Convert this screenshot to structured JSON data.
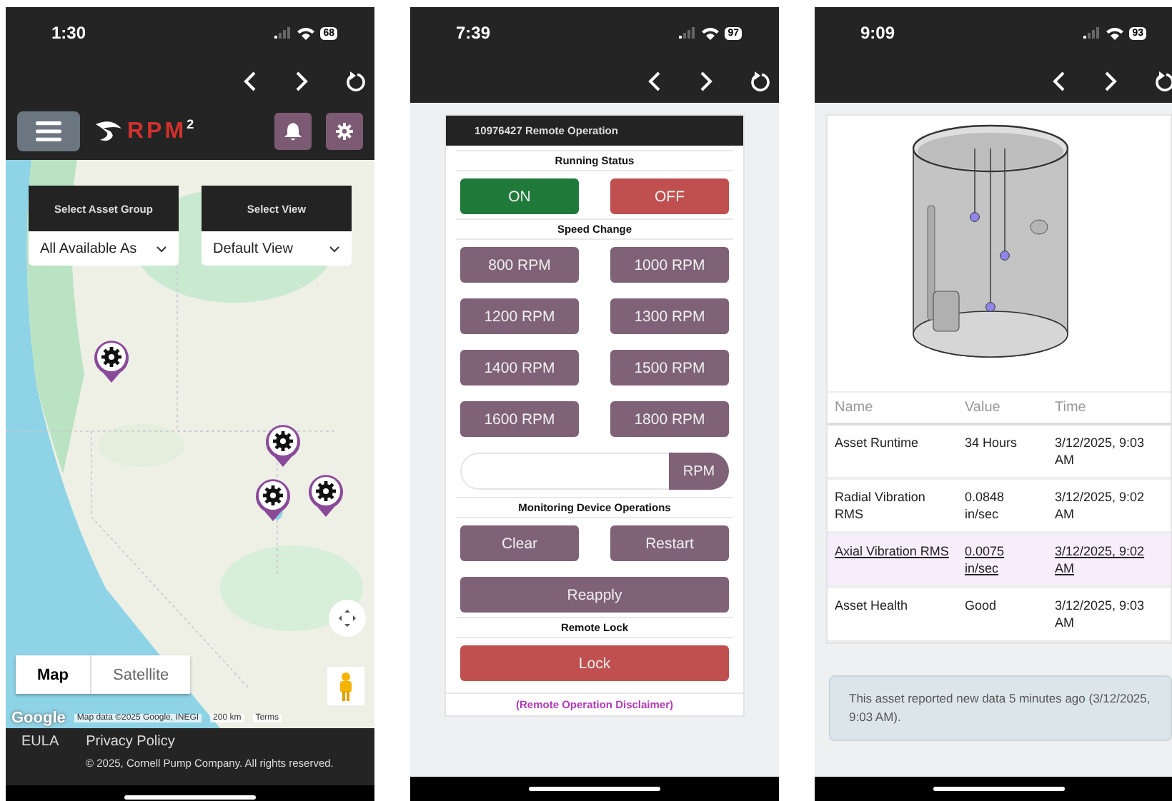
{
  "phones": [
    {
      "kind": "map",
      "time": "1:30",
      "battery": "68",
      "logo_text": "RPM",
      "logo_sup": "2",
      "selects": [
        {
          "label": "Select Asset Group",
          "value": "All Available As"
        },
        {
          "label": "Select View",
          "value": "Default View"
        }
      ],
      "map_types": [
        {
          "label": "Map",
          "selected": true
        },
        {
          "label": "Satellite",
          "selected": false
        }
      ],
      "attribution": {
        "logo": "Google",
        "data": "Map data ©2025 Google, INEGI",
        "scale": "200 km",
        "terms": "Terms"
      },
      "footer": {
        "links": [
          "EULA",
          "Privacy Policy"
        ],
        "copyright": "© 2025, Cornell Pump Company. All rights reserved."
      }
    },
    {
      "kind": "remote",
      "time": "7:39",
      "battery": "97",
      "title": "10976427 Remote Operation",
      "sections": [
        {
          "heading": "Running Status",
          "buttons": [
            {
              "label": "ON",
              "kind": "on"
            },
            {
              "label": "OFF",
              "kind": "off"
            }
          ]
        },
        {
          "heading": "Speed Change",
          "buttons": [
            {
              "label": "800 RPM",
              "kind": "action"
            },
            {
              "label": "1000 RPM",
              "kind": "action"
            },
            {
              "label": "1200 RPM",
              "kind": "action"
            },
            {
              "label": "1300 RPM",
              "kind": "action"
            },
            {
              "label": "1400 RPM",
              "kind": "action"
            },
            {
              "label": "1500 RPM",
              "kind": "action"
            },
            {
              "label": "1600 RPM",
              "kind": "action"
            },
            {
              "label": "1800 RPM",
              "kind": "action"
            }
          ],
          "field_addon": "RPM"
        },
        {
          "heading": "Monitoring Device Operations",
          "buttons": [
            {
              "label": "Clear",
              "kind": "action"
            },
            {
              "label": "Restart",
              "kind": "action"
            },
            {
              "label": "Reapply",
              "kind": "wide"
            }
          ]
        },
        {
          "heading": "Remote Lock",
          "buttons": [
            {
              "label": "Lock",
              "kind": "lock"
            }
          ]
        }
      ],
      "disclaimer": "(Remote Operation Disclaimer)"
    },
    {
      "kind": "asset",
      "time": "9:09",
      "battery": "93",
      "columns": [
        "Name",
        "Value",
        "Time"
      ],
      "rows": [
        {
          "cells": [
            "Asset Runtime",
            "34 Hours",
            "3/12/2025, 9:03 AM"
          ],
          "selected": false
        },
        {
          "cells": [
            "Radial Vibration RMS",
            "0.0848 in/sec",
            "3/12/2025, 9:02 AM"
          ],
          "selected": false
        },
        {
          "cells": [
            "Axial Vibration RMS",
            "0.0075 in/sec",
            "3/12/2025, 9:02 AM"
          ],
          "selected": true
        },
        {
          "cells": [
            "Asset Health",
            "Good",
            "3/12/2025, 9:03 AM"
          ],
          "selected": false
        }
      ],
      "notice": "This asset reported new data 5 minutes ago (3/12/2025, 9:03 AM)."
    }
  ]
}
